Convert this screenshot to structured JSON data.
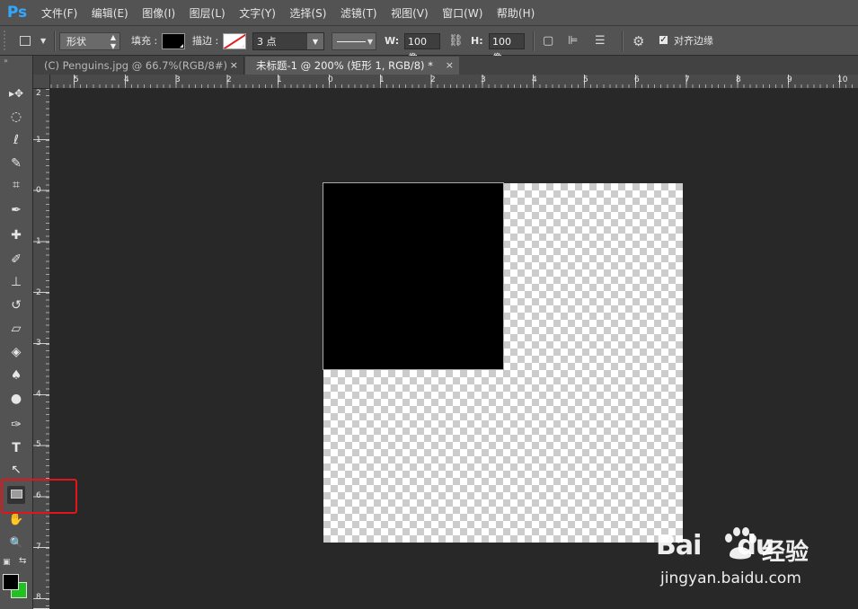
{
  "app": {
    "logo": "Ps"
  },
  "menu": [
    "文件(F)",
    "编辑(E)",
    "图像(I)",
    "图层(L)",
    "文字(Y)",
    "选择(S)",
    "滤镜(T)",
    "视图(V)",
    "窗口(W)",
    "帮助(H)"
  ],
  "options": {
    "mode": "形状",
    "fill_label": "填充 :",
    "fill_color": "#000000",
    "stroke_label": "描边 :",
    "stroke_width": "3 点",
    "w_label": "W:",
    "w_value": "100 像",
    "h_label": "H:",
    "h_value": "100 像",
    "align_edges_label": "对齐边缘",
    "align_edges_checked": true
  },
  "tabs": [
    {
      "label": "(C) Penguins.jpg @ 66.7%(RGB/8#)",
      "active": false,
      "close": "×"
    },
    {
      "label": "未标题-1 @ 200% (矩形 1, RGB/8) *",
      "active": true,
      "close": "×"
    }
  ],
  "ruler_h": [
    "5",
    "4",
    "3",
    "2",
    "1",
    "0",
    "1",
    "2",
    "3",
    "4",
    "5",
    "6",
    "7",
    "8",
    "9",
    "10"
  ],
  "ruler_v": [
    "2",
    "1",
    "0",
    "1",
    "2",
    "3",
    "4",
    "5",
    "6",
    "7",
    "8"
  ],
  "tools": [
    {
      "name": "move-tool",
      "glyph": "▸✥"
    },
    {
      "name": "elliptical-marquee-tool",
      "glyph": "◌"
    },
    {
      "name": "lasso-tool",
      "glyph": "ℓ"
    },
    {
      "name": "quick-selection-tool",
      "glyph": "✎"
    },
    {
      "name": "crop-tool",
      "glyph": "⌗"
    },
    {
      "name": "eyedropper-tool",
      "glyph": "✒"
    },
    {
      "name": "healing-brush-tool",
      "glyph": "✚"
    },
    {
      "name": "brush-tool",
      "glyph": "✐"
    },
    {
      "name": "clone-stamp-tool",
      "glyph": "⊥"
    },
    {
      "name": "history-brush-tool",
      "glyph": "↺"
    },
    {
      "name": "eraser-tool",
      "glyph": "▱"
    },
    {
      "name": "paint-bucket-tool",
      "glyph": "◈"
    },
    {
      "name": "blur-tool",
      "glyph": "♠"
    },
    {
      "name": "dodge-tool",
      "glyph": "●"
    },
    {
      "name": "pen-tool",
      "glyph": "✑"
    },
    {
      "name": "type-tool",
      "glyph": "T"
    },
    {
      "name": "path-selection-tool",
      "glyph": "↖"
    },
    {
      "name": "rectangle-tool",
      "glyph": ""
    },
    {
      "name": "hand-tool",
      "glyph": "✋"
    },
    {
      "name": "zoom-tool",
      "glyph": "🔍"
    }
  ],
  "colors": {
    "foreground": "#000000",
    "background": "#22c122",
    "highlight": "#e4141a"
  },
  "watermark": {
    "logo": "Bai",
    "logo_tail": "du",
    "cn": "经验",
    "url": "jingyan.baidu.com"
  }
}
